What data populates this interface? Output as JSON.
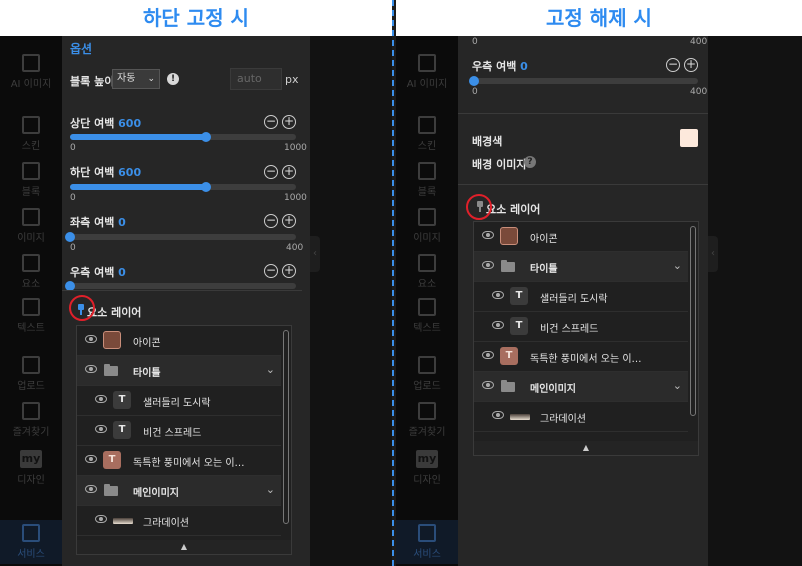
{
  "left": {
    "caption": "하단 고정 시",
    "sidebar": [
      {
        "label": "AI 이미지",
        "icon": "ai-image-icon"
      },
      {
        "label": "스킨",
        "icon": "skin-icon"
      },
      {
        "label": "블록",
        "icon": "block-icon"
      },
      {
        "label": "이미지",
        "icon": "image-icon"
      },
      {
        "label": "요소",
        "icon": "elements-icon"
      },
      {
        "label": "텍스트",
        "icon": "text-icon"
      },
      {
        "label": "업로드",
        "icon": "upload-icon"
      },
      {
        "label": "즐겨찾기",
        "icon": "bookmark-icon"
      },
      {
        "label": "디자인",
        "icon": "my-design-icon",
        "badge": "my"
      },
      {
        "label": "서비스",
        "icon": "service-icon"
      }
    ],
    "options_title": "옵션",
    "block_height": {
      "label": "블록 높이",
      "select": "자동",
      "input_placeholder": "auto",
      "unit": "px"
    },
    "sliders": [
      {
        "label": "상단 여백",
        "value": "600",
        "fraction": 0.6,
        "min": "0",
        "max": "1000"
      },
      {
        "label": "하단 여백",
        "value": "600",
        "fraction": 0.6,
        "min": "0",
        "max": "1000"
      },
      {
        "label": "좌측 여백",
        "value": "0",
        "fraction": 0.0,
        "min": "0",
        "max": "400"
      },
      {
        "label": "우측 여백",
        "value": "0",
        "fraction": 0.0
      }
    ],
    "layer_title": "요소 레이어",
    "layers": [
      {
        "name": "아이콘",
        "kind": "icon"
      },
      {
        "name": "타이틀",
        "kind": "folder"
      },
      {
        "name": "샐러들리 도시락",
        "kind": "text",
        "glyph": "T"
      },
      {
        "name": "비건 스프레드",
        "kind": "text",
        "glyph": "T"
      },
      {
        "name": "독특한 풍미에서 오는 이…",
        "kind": "text-colored",
        "glyph": "T"
      },
      {
        "name": "메인이미지",
        "kind": "folder"
      },
      {
        "name": "그라데이션",
        "kind": "gradient"
      }
    ],
    "pin_state": "fixed"
  },
  "right": {
    "caption": "고정 해제 시",
    "sidebar": [
      {
        "label": "AI 이미지",
        "icon": "ai-image-icon"
      },
      {
        "label": "스킨",
        "icon": "skin-icon"
      },
      {
        "label": "블록",
        "icon": "block-icon"
      },
      {
        "label": "이미지",
        "icon": "image-icon"
      },
      {
        "label": "요소",
        "icon": "elements-icon"
      },
      {
        "label": "텍스트",
        "icon": "text-icon"
      },
      {
        "label": "업로드",
        "icon": "upload-icon"
      },
      {
        "label": "즐겨찾기",
        "icon": "bookmark-icon"
      },
      {
        "label": "디자인",
        "icon": "my-design-icon",
        "badge": "my"
      },
      {
        "label": "서비스",
        "icon": "service-icon"
      }
    ],
    "top_slider": {
      "min": "0",
      "max": "400"
    },
    "right_margin": {
      "label": "우측 여백",
      "value": "0",
      "fraction": 0.0,
      "min": "0",
      "max": "400"
    },
    "bg_color_label": "배경색",
    "bg_color": "#fde9dc",
    "bg_image_label": "배경 이미지",
    "layer_title": "요소 레이어",
    "layers": [
      {
        "name": "아이콘",
        "kind": "icon"
      },
      {
        "name": "타이틀",
        "kind": "folder"
      },
      {
        "name": "샐러들리 도시락",
        "kind": "text",
        "glyph": "T"
      },
      {
        "name": "비건 스프레드",
        "kind": "text",
        "glyph": "T"
      },
      {
        "name": "독특한 풍미에서 오는 이…",
        "kind": "text-colored",
        "glyph": "T"
      },
      {
        "name": "메인이미지",
        "kind": "folder"
      },
      {
        "name": "그라데이션",
        "kind": "gradient"
      }
    ],
    "pin_state": "unfixed"
  },
  "colors": {
    "accent": "#3b8fe8",
    "highlight_circle": "#e0202a",
    "caption": "#2e8bf0"
  }
}
